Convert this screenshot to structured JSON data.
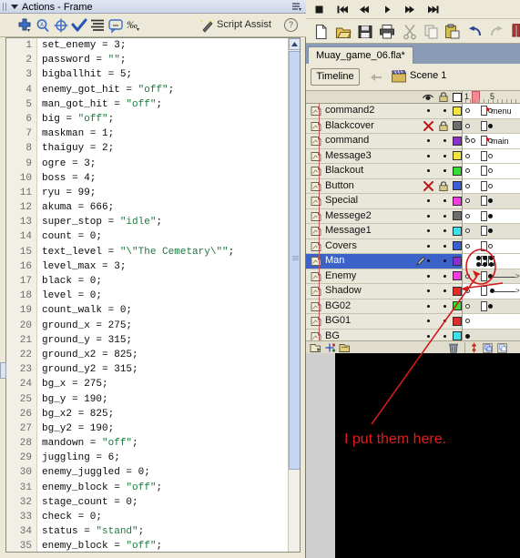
{
  "actions_panel": {
    "title": "Actions - Frame",
    "menu_icon": "panel-menu-icon",
    "collapse_icon": "chevron-down-icon",
    "toolbar": [
      {
        "name": "add-item-icon",
        "label": "+"
      },
      {
        "name": "find-icon",
        "label": "Find"
      },
      {
        "name": "insert-target-path-icon",
        "label": "Insert Target Path"
      },
      {
        "name": "check-syntax-icon",
        "label": "Check Syntax"
      },
      {
        "name": "auto-format-icon",
        "label": "Auto Format"
      },
      {
        "name": "show-code-hint-icon",
        "label": "Show Code Hint"
      },
      {
        "name": "debug-options-icon",
        "label": "Debug Options"
      }
    ],
    "script_assist": {
      "label": "Script Assist",
      "wand_icon": "magic-wand-icon",
      "help_icon": "help-icon",
      "help_label": "?"
    },
    "code_lines": [
      {
        "n": 1,
        "text": "set_enemy = 3;"
      },
      {
        "n": 2,
        "text": "password = \"\";"
      },
      {
        "n": 3,
        "text": "bigballhit = 5;"
      },
      {
        "n": 4,
        "text": "enemy_got_hit = \"off\";"
      },
      {
        "n": 5,
        "text": "man_got_hit = \"off\";"
      },
      {
        "n": 6,
        "text": "big = \"off\";"
      },
      {
        "n": 7,
        "text": "maskman = 1;"
      },
      {
        "n": 8,
        "text": "thaiguy = 2;"
      },
      {
        "n": 9,
        "text": "ogre = 3;"
      },
      {
        "n": 10,
        "text": "boss = 4;"
      },
      {
        "n": 11,
        "text": "ryu = 99;"
      },
      {
        "n": 12,
        "text": "akuma = 666;"
      },
      {
        "n": 13,
        "text": "super_stop = \"idle\";"
      },
      {
        "n": 14,
        "text": "count = 0;"
      },
      {
        "n": 15,
        "text": "text_level = \"\\\"The Cemetary\\\"\";"
      },
      {
        "n": 16,
        "text": "level_max = 3;"
      },
      {
        "n": 17,
        "text": "black = 0;"
      },
      {
        "n": 18,
        "text": "level = 0;"
      },
      {
        "n": 19,
        "text": "count_walk = 0;"
      },
      {
        "n": 20,
        "text": "ground_x = 275;"
      },
      {
        "n": 21,
        "text": "ground_y = 315;"
      },
      {
        "n": 22,
        "text": "ground_x2 = 825;"
      },
      {
        "n": 23,
        "text": "ground_y2 = 315;"
      },
      {
        "n": 24,
        "text": "bg_x = 275;"
      },
      {
        "n": 25,
        "text": "bg_y = 190;"
      },
      {
        "n": 26,
        "text": "bg_x2 = 825;"
      },
      {
        "n": 27,
        "text": "bg_y2 = 190;"
      },
      {
        "n": 28,
        "text": "mandown = \"off\";"
      },
      {
        "n": 29,
        "text": "juggling = 6;"
      },
      {
        "n": 30,
        "text": "enemy_juggled = 0;"
      },
      {
        "n": 31,
        "text": "enemy_block = \"off\";"
      },
      {
        "n": 32,
        "text": "stage_count = 0;"
      },
      {
        "n": 33,
        "text": "check = 0;"
      },
      {
        "n": 34,
        "text": "status = \"stand\";"
      },
      {
        "n": 35,
        "text": "enemy_block = \"off\";"
      }
    ]
  },
  "flash_window": {
    "playback_controls": [
      {
        "name": "stop-button",
        "glyph": "stop"
      },
      {
        "name": "rewind-button",
        "glyph": "skip-back"
      },
      {
        "name": "step-back-button",
        "glyph": "step-back"
      },
      {
        "name": "play-button",
        "glyph": "play"
      },
      {
        "name": "step-forward-button",
        "glyph": "step-forward"
      },
      {
        "name": "go-to-end-button",
        "glyph": "skip-forward"
      }
    ],
    "main_toolbar": [
      {
        "name": "new-file-icon",
        "label": "New"
      },
      {
        "name": "open-file-icon",
        "label": "Open"
      },
      {
        "name": "save-file-icon",
        "label": "Save"
      },
      {
        "name": "print-icon",
        "label": "Print"
      },
      {
        "name": "cut-icon",
        "label": "Cut"
      },
      {
        "name": "copy-icon",
        "label": "Copy"
      },
      {
        "name": "paste-icon",
        "label": "Paste"
      },
      {
        "name": "undo-icon",
        "label": "Undo"
      },
      {
        "name": "redo-icon",
        "label": "Redo"
      },
      {
        "name": "snap-to-objects-icon",
        "label": "Snap to Objects"
      }
    ],
    "document_tab": "Muay_game_06.fla*",
    "timeline_button": "Timeline",
    "back_arrow_icon": "back-arrow-icon",
    "scene_icon": "scene-icon",
    "scene_label": "Scene 1",
    "layer_header": {
      "eye_icon": "eye-icon",
      "lock_icon": "lock-icon",
      "outline_icon": "outline-square-icon"
    },
    "ruler": {
      "ticks": [
        1,
        5
      ],
      "playhead_frame": 1
    },
    "layers": [
      {
        "name": "command2",
        "color": "#f2e43c",
        "locked": false,
        "hidden": false,
        "selected": false
      },
      {
        "name": "Blackcover",
        "color": "#6e6e6e",
        "locked": true,
        "hidden": true,
        "selected": false
      },
      {
        "name": "command",
        "color": "#8b2fcf",
        "locked": false,
        "hidden": false,
        "selected": false
      },
      {
        "name": "Message3",
        "color": "#f2e43c",
        "locked": false,
        "hidden": false,
        "selected": false
      },
      {
        "name": "Blackout",
        "color": "#35dd35",
        "locked": false,
        "hidden": false,
        "selected": false
      },
      {
        "name": "Button",
        "color": "#3b5fd4",
        "locked": true,
        "hidden": true,
        "selected": false
      },
      {
        "name": "Special",
        "color": "#f23ce0",
        "locked": false,
        "hidden": false,
        "selected": false
      },
      {
        "name": "Messege2",
        "color": "#6e6e6e",
        "locked": false,
        "hidden": false,
        "selected": false
      },
      {
        "name": "Message1",
        "color": "#3ce0ea",
        "locked": false,
        "hidden": false,
        "selected": false
      },
      {
        "name": "Covers",
        "color": "#3b5fd4",
        "locked": false,
        "hidden": false,
        "selected": false
      },
      {
        "name": "Man",
        "color": "#8b2fcf",
        "locked": false,
        "hidden": false,
        "selected": true
      },
      {
        "name": "Enemy",
        "color": "#f23ce0",
        "locked": false,
        "hidden": false,
        "selected": false
      },
      {
        "name": "Shadow",
        "color": "#e02b2b",
        "locked": false,
        "hidden": false,
        "selected": false
      },
      {
        "name": "BG02",
        "color": "#35dd35",
        "locked": false,
        "hidden": false,
        "selected": false
      },
      {
        "name": "BG01",
        "color": "#e02b2b",
        "locked": false,
        "hidden": false,
        "selected": false
      },
      {
        "name": "BG",
        "color": "#3ce0ea",
        "locked": false,
        "hidden": false,
        "selected": false
      }
    ],
    "frame_labels": [
      "menu",
      "main"
    ],
    "timeline_footer": {
      "insert_layer_icon": "insert-layer-icon",
      "add_motion_guide_icon": "add-motion-guide-icon",
      "insert_layer_folder_icon": "insert-layer-folder-icon",
      "delete_layer_icon": "trash-icon",
      "onion_skin_icon": "onion-skin-icon",
      "center_frame_icon": "center-frame-icon",
      "edit_multiple_frames_icon": "edit-multiple-frames-icon"
    },
    "stage_annotation": "I put them here."
  },
  "annotation": {
    "color": "#d61f1f",
    "text": "I put them here."
  }
}
